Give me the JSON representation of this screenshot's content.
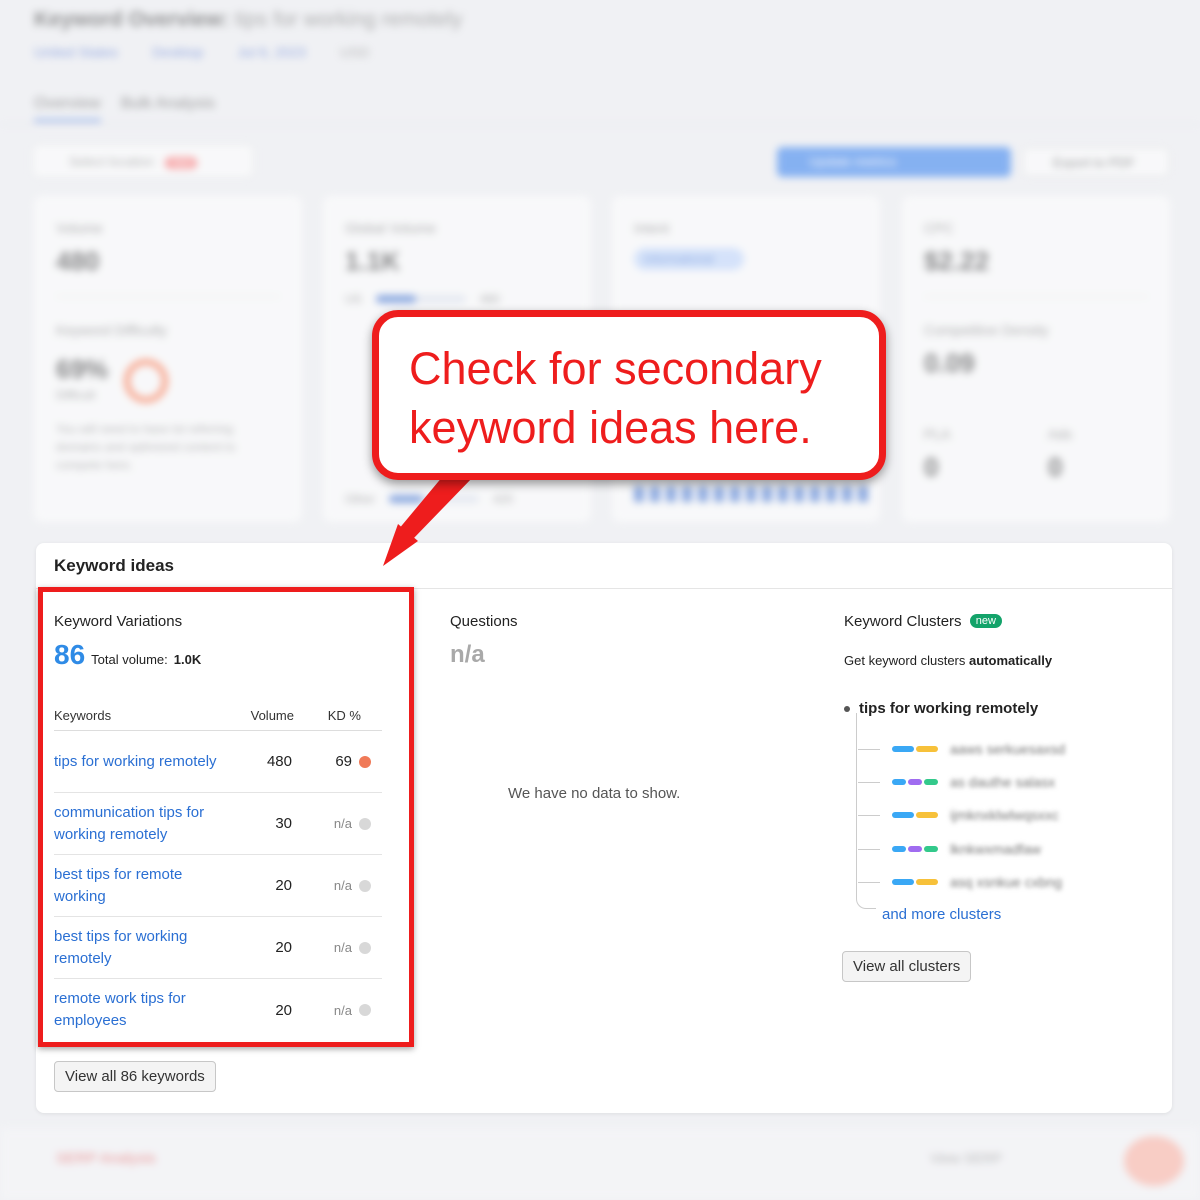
{
  "callout": {
    "line1": "Check for secondary",
    "line2": "keyword ideas here."
  },
  "panel": {
    "title": "Keyword ideas"
  },
  "variations": {
    "title": "Keyword Variations",
    "count": "86",
    "total_label": "Total volume:",
    "total_value": "1.0K",
    "headers": {
      "keyword": "Keywords",
      "volume": "Volume",
      "kd": "KD %"
    },
    "rows": [
      {
        "keyword": "tips for working remotely",
        "volume": "480",
        "kd": "69",
        "kd_color": "#f07a58"
      },
      {
        "keyword": "communication tips for working remotely",
        "volume": "30",
        "kd": "n/a",
        "kd_color": "#d8d8d8"
      },
      {
        "keyword": "best tips for remote working",
        "volume": "20",
        "kd": "n/a",
        "kd_color": "#d8d8d8"
      },
      {
        "keyword": "best tips for working remotely",
        "volume": "20",
        "kd": "n/a",
        "kd_color": "#d8d8d8"
      },
      {
        "keyword": "remote work tips for employees",
        "volume": "20",
        "kd": "n/a",
        "kd_color": "#d8d8d8"
      }
    ],
    "view_all_label": "View all 86 keywords"
  },
  "questions": {
    "title": "Questions",
    "value": "n/a",
    "empty_message": "We have no data to show."
  },
  "clusters": {
    "title": "Keyword Clusters",
    "badge": "new",
    "desc_prefix": "Get keyword clusters",
    "desc_bold": "automatically",
    "root": "tips for working remotely",
    "more_label": "and more clusters",
    "view_all_label": "View all clusters"
  },
  "background": {
    "title": "Keyword Overview:",
    "title_query": "tips for working remotely",
    "filters": [
      "United States",
      "Desktop",
      "Jul 6, 2023",
      "USD"
    ],
    "tabs": [
      "Overview",
      "Bulk Analysis"
    ],
    "select_placeholder": "Select location",
    "select_badge": "new",
    "update_button": "Update metrics",
    "export_button": "Export to PDF",
    "cards": {
      "volume_label": "Volume",
      "volume_value": "480",
      "kd_label": "Keyword Difficulty",
      "kd_value": "69%",
      "kd_level": "Difficult",
      "kd_hint": "You will need to have lot referring domains and optimized content to compete here.",
      "global_label": "Global Volume",
      "global_value": "1.1K",
      "global_first_country": "US",
      "global_first_value": "480",
      "global_other_label": "Other",
      "global_other_value": "420",
      "intent_label": "Intent",
      "intent_value": "Informational",
      "cpc_label": "CPC",
      "cpc_value": "$2.22",
      "density_label": "Competitive Density",
      "density_value": "0.09",
      "pla_label": "PLA",
      "pla_value": "0",
      "ads_label": "Ads",
      "ads_value": "0"
    },
    "footer_left": "SERP Analysis",
    "footer_right": "View SERP"
  },
  "colors": {
    "accent_red": "#ee1d1d",
    "link_blue": "#2a6fd3",
    "count_blue": "#2f8be6",
    "new_badge_green": "#13a36a"
  }
}
